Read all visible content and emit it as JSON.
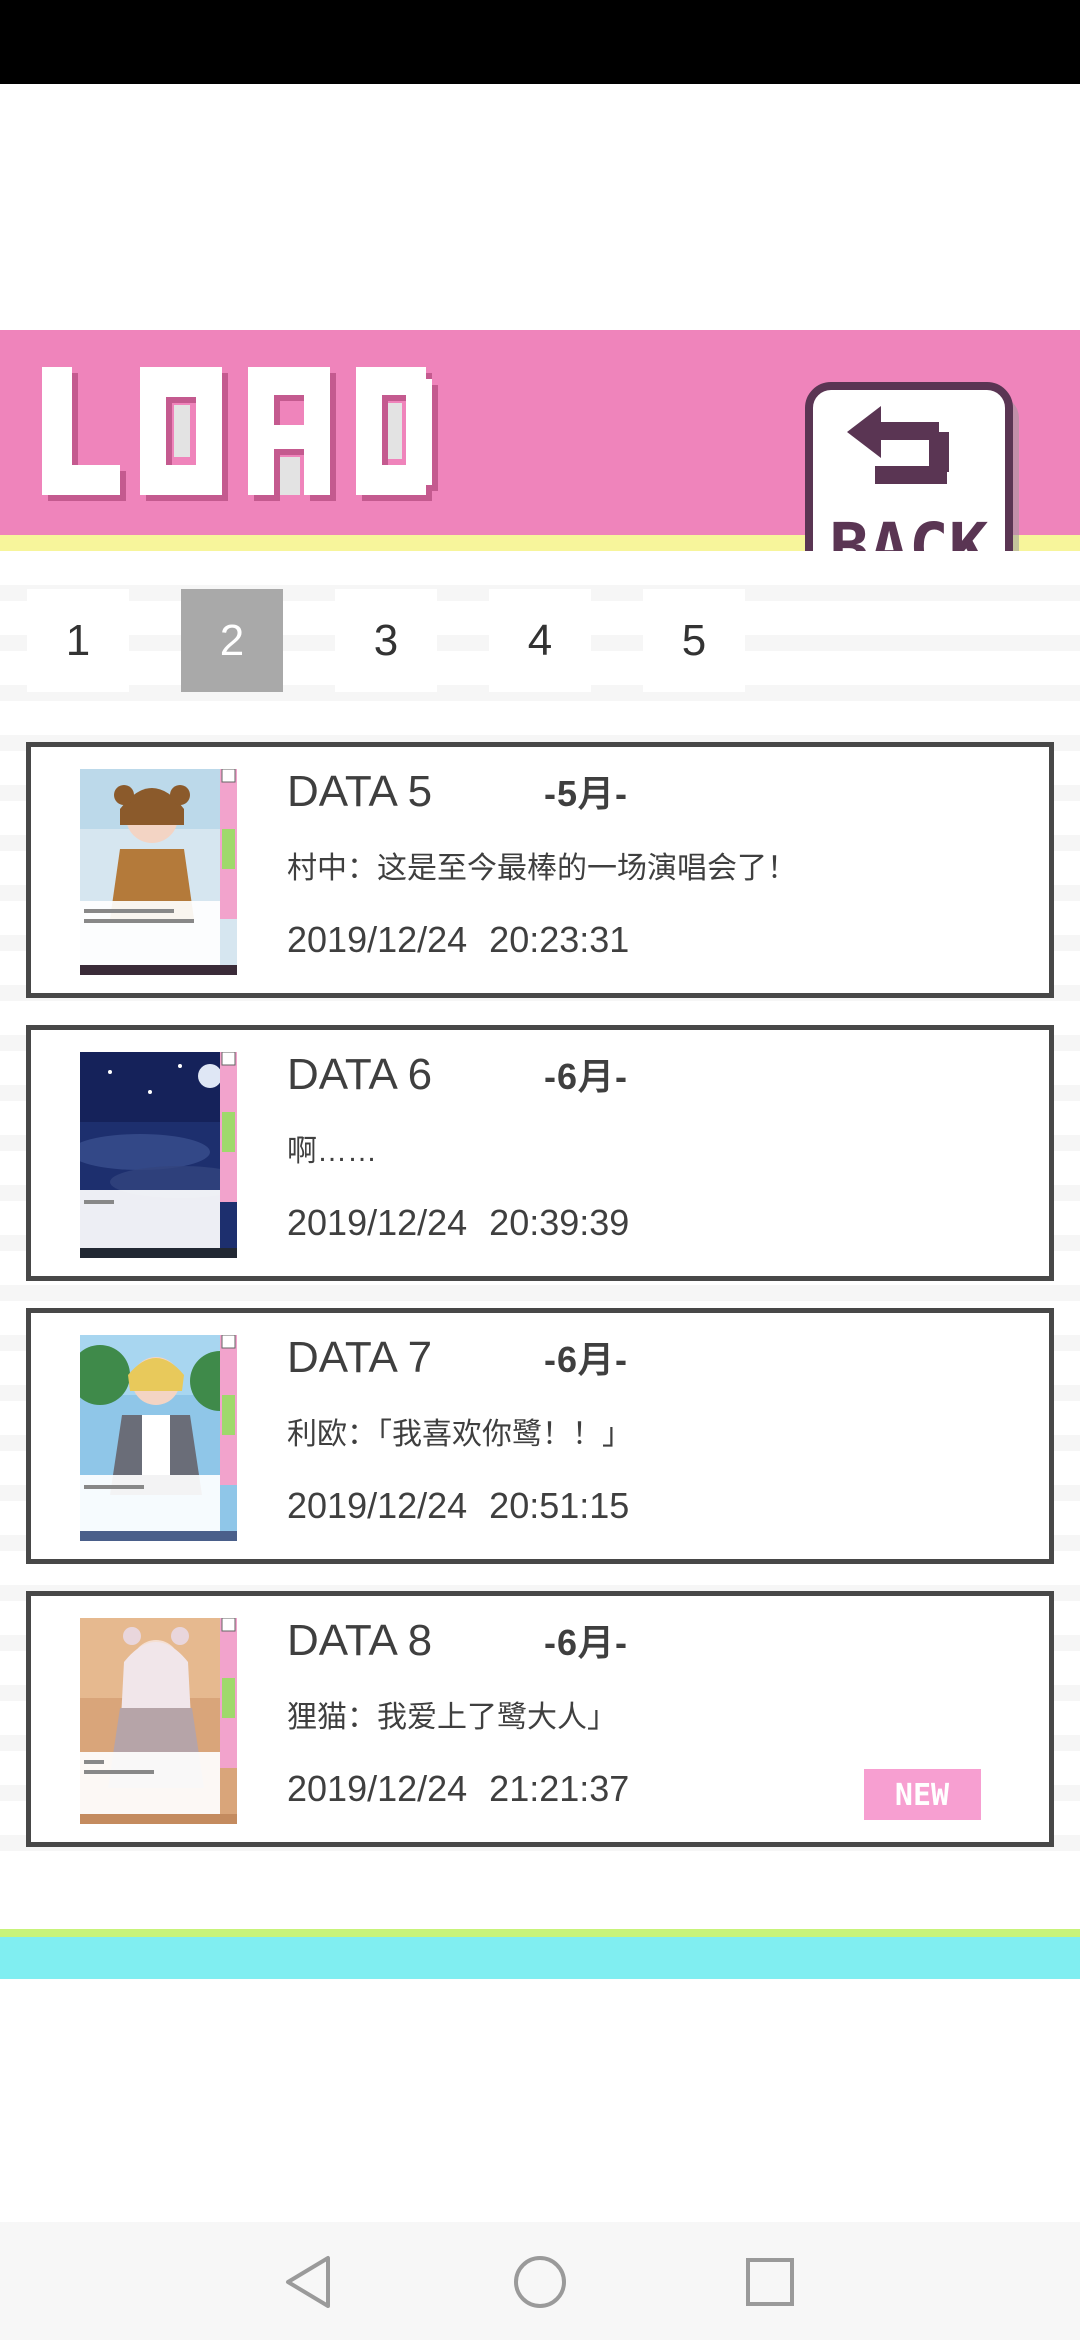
{
  "header": {
    "title": "LOAD",
    "back_label": "BACK"
  },
  "tabs": [
    {
      "label": "1",
      "active": false
    },
    {
      "label": "2",
      "active": true
    },
    {
      "label": "3",
      "active": false
    },
    {
      "label": "4",
      "active": false
    },
    {
      "label": "5",
      "active": false
    }
  ],
  "slots": [
    {
      "title": "DATA 5",
      "month": "-5月-",
      "line": "村中：这是至今最棒的一场演唱会了！",
      "timestamp": "2019/12/24  20:23:31",
      "is_new": false
    },
    {
      "title": "DATA 6",
      "month": "-6月-",
      "line": "啊……",
      "timestamp": "2019/12/24  20:39:39",
      "is_new": false
    },
    {
      "title": "DATA 7",
      "month": "-6月-",
      "line": "利欧：「我喜欢你鹭！！」",
      "timestamp": "2019/12/24  20:51:15",
      "is_new": false
    },
    {
      "title": "DATA 8",
      "month": "-6月-",
      "line": "狸猫：我爱上了鹭大人」",
      "timestamp": "2019/12/24  21:21:37",
      "is_new": true,
      "badge": "NEW"
    }
  ],
  "colors": {
    "header_pink": "#ef84bb",
    "header_yellow": "#f7f59b",
    "back_dark": "#5a3553",
    "tab_active": "#a9a9a9",
    "card_border": "#484848",
    "new_pink": "#f79fd1",
    "bottom_green": "#c8f37a",
    "bottom_cyan": "#80eef1"
  },
  "nav": {
    "icons": [
      "back-triangle-icon",
      "home-circle-icon",
      "recents-square-icon"
    ]
  }
}
